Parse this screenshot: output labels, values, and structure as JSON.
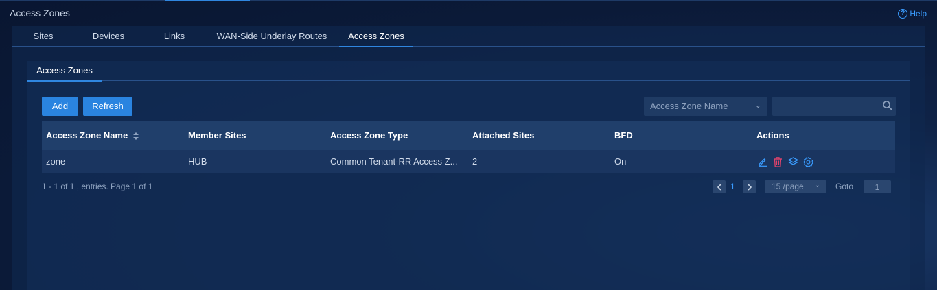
{
  "page": {
    "title": "Access Zones",
    "help_label": "Help"
  },
  "tabs": [
    {
      "label": "Sites"
    },
    {
      "label": "Devices"
    },
    {
      "label": "Links"
    },
    {
      "label": "WAN-Side Underlay Routes"
    },
    {
      "label": "Access Zones",
      "active": true
    }
  ],
  "sub_tab": {
    "label": "Access Zones"
  },
  "toolbar": {
    "add_label": "Add",
    "refresh_label": "Refresh",
    "filter_select": "Access Zone Name",
    "search_value": ""
  },
  "table": {
    "columns": [
      "Access Zone Name",
      "Member Sites",
      "Access Zone Type",
      "Attached Sites",
      "BFD",
      "Actions"
    ],
    "rows": [
      {
        "name": "zone",
        "member_sites": "HUB",
        "type": "Common Tenant-RR Access Z...",
        "attached_sites": "2",
        "bfd": "On",
        "actions": [
          "edit-icon",
          "delete-icon",
          "layers-icon",
          "settings-icon"
        ]
      }
    ]
  },
  "pagination": {
    "summary": "1 - 1 of 1 , entries. Page 1 of 1",
    "current_page": "1",
    "per_page": "15 /page",
    "goto_label": "Goto",
    "goto_value": "1"
  },
  "colors": {
    "accent": "#2f86e0",
    "delete": "#e0436b",
    "link": "#3a9cff"
  }
}
